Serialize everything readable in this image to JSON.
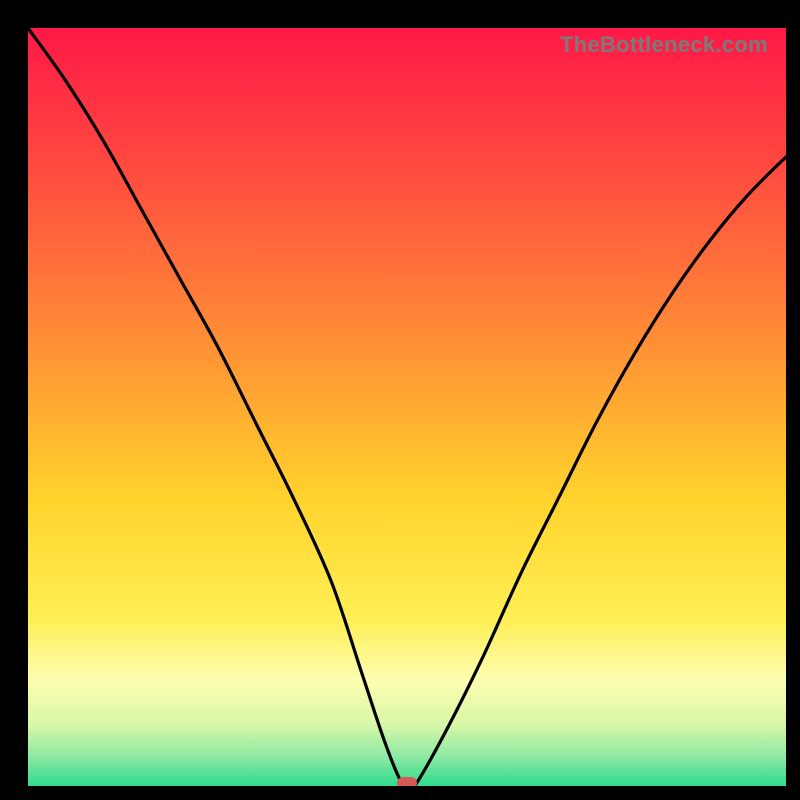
{
  "watermark": "TheBottleneck.com",
  "colors": {
    "frame": "#000000",
    "gradient_stops": [
      {
        "offset": 0.0,
        "color": "#ff1846"
      },
      {
        "offset": 0.18,
        "color": "#ff4940"
      },
      {
        "offset": 0.4,
        "color": "#ff8a36"
      },
      {
        "offset": 0.62,
        "color": "#ffd32c"
      },
      {
        "offset": 0.78,
        "color": "#ffef55"
      },
      {
        "offset": 0.86,
        "color": "#fdfdb0"
      },
      {
        "offset": 0.92,
        "color": "#d7f7a8"
      },
      {
        "offset": 0.96,
        "color": "#8fe9a4"
      },
      {
        "offset": 1.0,
        "color": "#2fdc8e"
      }
    ],
    "curve": "#000000",
    "marker": "#d45a55"
  },
  "chart_data": {
    "type": "line",
    "title": "",
    "xlabel": "",
    "ylabel": "",
    "xlim": [
      0,
      100
    ],
    "ylim": [
      0,
      100
    ],
    "series": [
      {
        "name": "bottleneck-curve",
        "x": [
          0,
          5,
          10,
          15,
          20,
          25,
          30,
          35,
          40,
          44,
          47,
          49,
          50,
          51,
          55,
          60,
          65,
          70,
          75,
          80,
          85,
          90,
          95,
          100
        ],
        "values": [
          100,
          93,
          85,
          76,
          67,
          58,
          48,
          38,
          27,
          15,
          6,
          1,
          0,
          0,
          7,
          17,
          28,
          38,
          48,
          57,
          65,
          72,
          78,
          83
        ]
      }
    ],
    "marker": {
      "x": 50,
      "y": 0
    }
  }
}
